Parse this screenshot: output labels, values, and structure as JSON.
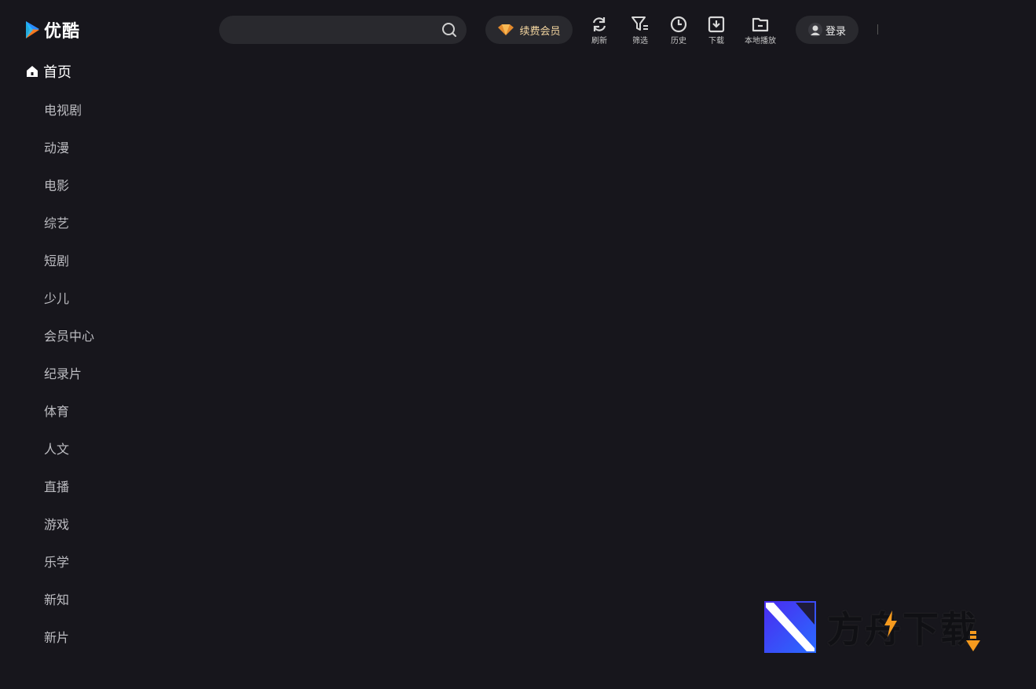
{
  "app": {
    "logo_text": "优酷",
    "brand_colors": {
      "blue": "#2a8cff",
      "orange": "#ff7a1a"
    }
  },
  "search": {
    "placeholder": "",
    "value": ""
  },
  "vip": {
    "label": "续费会员",
    "icon": "diamond-icon"
  },
  "toolbar": {
    "refresh": "刷新",
    "filter": "筛选",
    "history": "历史",
    "download": "下载",
    "local_play": "本地播放"
  },
  "login": {
    "label": "登录",
    "icon": "user-avatar-icon"
  },
  "nav": {
    "home": "首页",
    "items": [
      "电视剧",
      "动漫",
      "电影",
      "综艺",
      "短剧",
      "少儿",
      "会员中心",
      "纪录片",
      "体育",
      "人文",
      "直播",
      "游戏",
      "乐学",
      "新知",
      "新片"
    ]
  },
  "watermark": {
    "text": "方舟下载"
  }
}
